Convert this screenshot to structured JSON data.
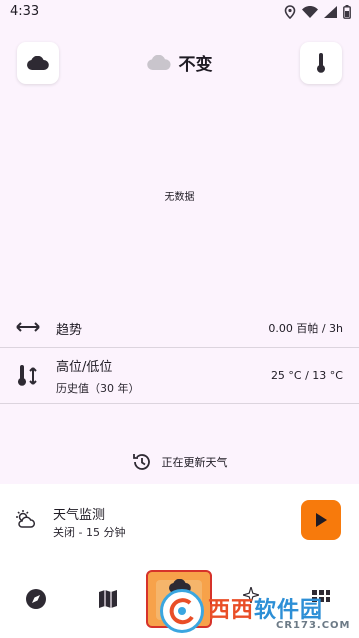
{
  "status_bar": {
    "time": "4:33"
  },
  "header": {
    "title": "不变"
  },
  "chart": {
    "no_data": "无数据"
  },
  "trend": {
    "label": "趋势",
    "value": "0.00 百帕 / 3h"
  },
  "hilo": {
    "label": "高位/低位",
    "sub": "历史值（30 年）",
    "value": "25 °C / 13 °C"
  },
  "status": {
    "updating": "正在更新天气"
  },
  "monitor": {
    "title": "天气监测",
    "subtitle": "关闭 - 15 分钟"
  },
  "watermark": {
    "brand_a": "西西",
    "brand_b": "软件园",
    "url": "CR173.COM"
  },
  "colors": {
    "background": "#fcf3fd",
    "accent": "#f77a0c",
    "watermark_blue": "#2d8fd6",
    "watermark_red": "#e94e27"
  }
}
